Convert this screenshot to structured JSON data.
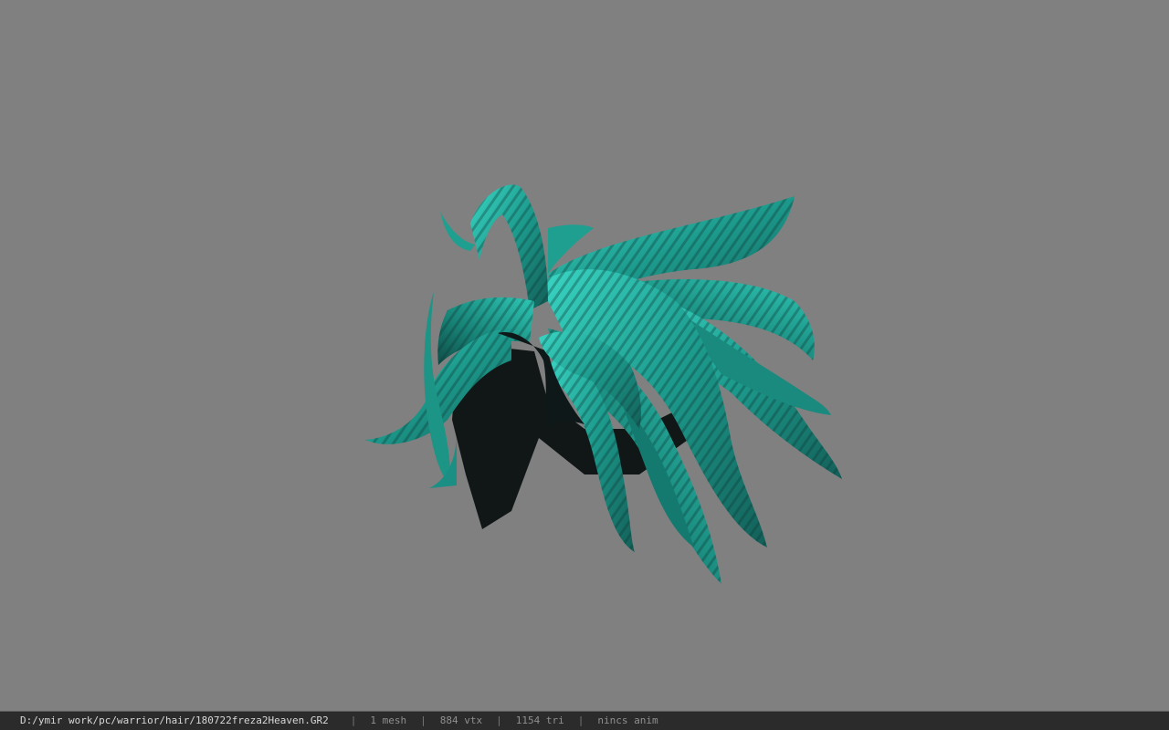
{
  "colors": {
    "viewport_bg": "#808080",
    "statusbar_bg": "#2b2b2b",
    "hair_light": "#2fc4b2",
    "hair_mid": "#1b8f84",
    "hair_dark": "#121c1c"
  },
  "statusbar": {
    "file_path": "D:/ymir work/pc/warrior/hair/180722freza2Heaven.GR2",
    "separator": "|",
    "mesh_count": "1 mesh",
    "vertex_count": "884 vtx",
    "triangle_count": "1154 tri",
    "anim_status": "nincs anim"
  }
}
